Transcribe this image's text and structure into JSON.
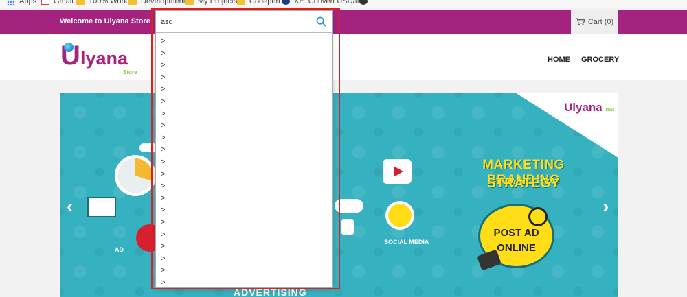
{
  "bookmarks": [
    "Apps",
    "Gmail",
    "100% Works",
    "Development",
    "My Projects",
    "Codepen",
    "XE: Convert USD/IN..."
  ],
  "topbar": {
    "welcome": "Welcome to Ulyana Store",
    "cart_label": "Cart (0)"
  },
  "logo": {
    "letter": "U",
    "name": "lyana",
    "tagline": "Store"
  },
  "nav": {
    "home": "HOME",
    "grocery": "GROCERY"
  },
  "banner": {
    "corner_logo": "Ulyana",
    "corner_logo_sub": "Mart",
    "headline_1": "MARKETING BRANDING",
    "headline_2": "STRATEGY",
    "bubble_1": "POST AD",
    "bubble_2": "ONLINE",
    "label_social": "SOCIAL MEDIA",
    "label_ad": "AD",
    "label_advertising": "ADVERTISING",
    "prev_arrow": "‹",
    "next_arrow": "›"
  },
  "search": {
    "value": "asd",
    "suggestions": [
      ">",
      ">",
      ">",
      ">",
      ">",
      ">",
      ">",
      ">",
      ">",
      ">",
      ">",
      ">",
      ">",
      ">",
      ">",
      ">",
      ">",
      ">",
      ">",
      ">",
      ">"
    ]
  },
  "colors": {
    "brand_purple": "#a3237f",
    "banner_teal": "#36b1bf",
    "highlight_red": "#e0201f",
    "accent_yellow": "#ffde17"
  }
}
